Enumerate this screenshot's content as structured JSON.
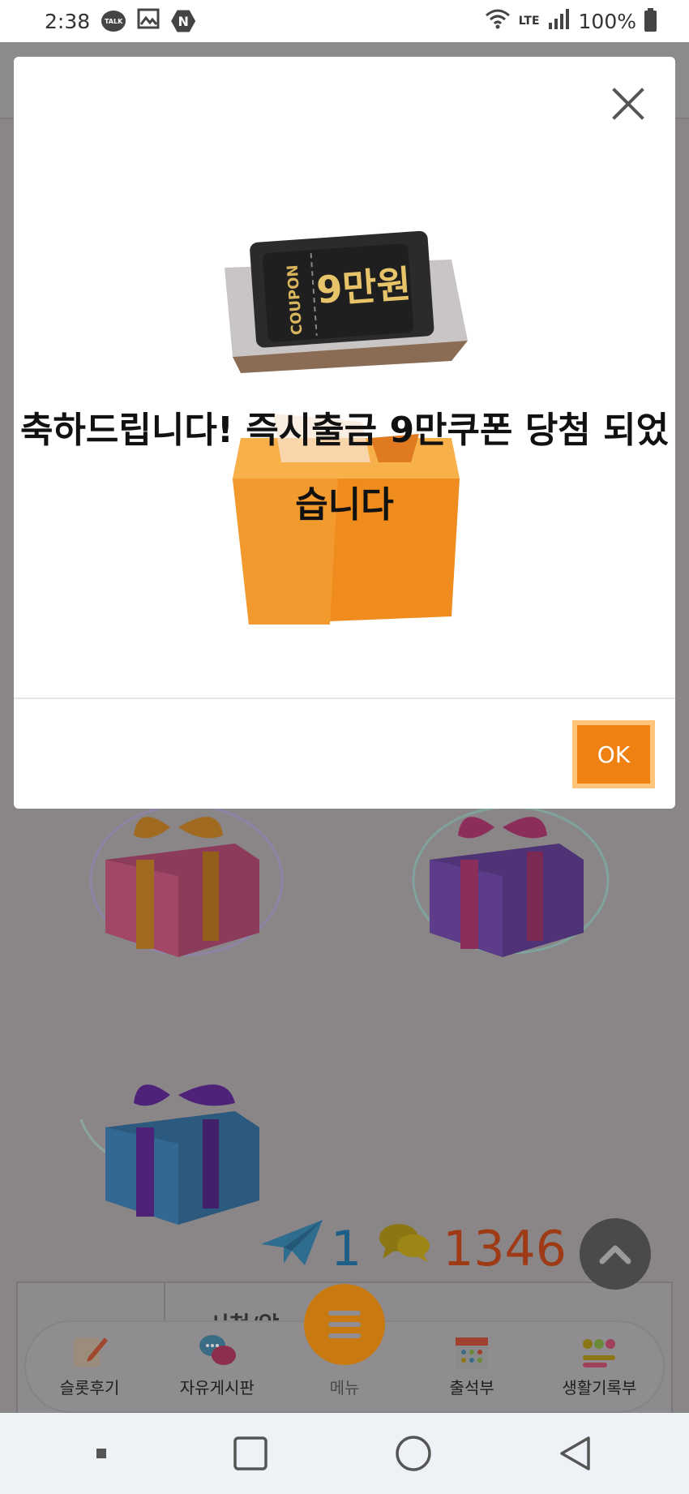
{
  "status_bar": {
    "time": "2:38",
    "talk_badge": "TALK",
    "n_badge": "N",
    "network": "LTE",
    "battery": "100%"
  },
  "modal": {
    "coupon_label": "COUPON",
    "coupon_amount": "9만원",
    "message": "축하드립니다! 즉시출금 9만쿠폰 당첨 되었습니다",
    "ok_label": "OK"
  },
  "stats": {
    "plane_count": "1",
    "comment_count": "1346"
  },
  "background": {
    "partial_cell_text": "시청/알"
  },
  "bottom_nav": [
    {
      "label": "슬롯후기",
      "icon": "review-icon"
    },
    {
      "label": "자유게시판",
      "icon": "chat-bubbles-icon"
    },
    {
      "label": "메뉴",
      "icon": "hamburger-menu-icon"
    },
    {
      "label": "출석부",
      "icon": "calendar-icon"
    },
    {
      "label": "생활기록부",
      "icon": "emoji-record-icon"
    }
  ],
  "colors": {
    "accent": "#EF8012",
    "ok_border": "#FFC47A",
    "dim_overlay": "#8A8688"
  }
}
